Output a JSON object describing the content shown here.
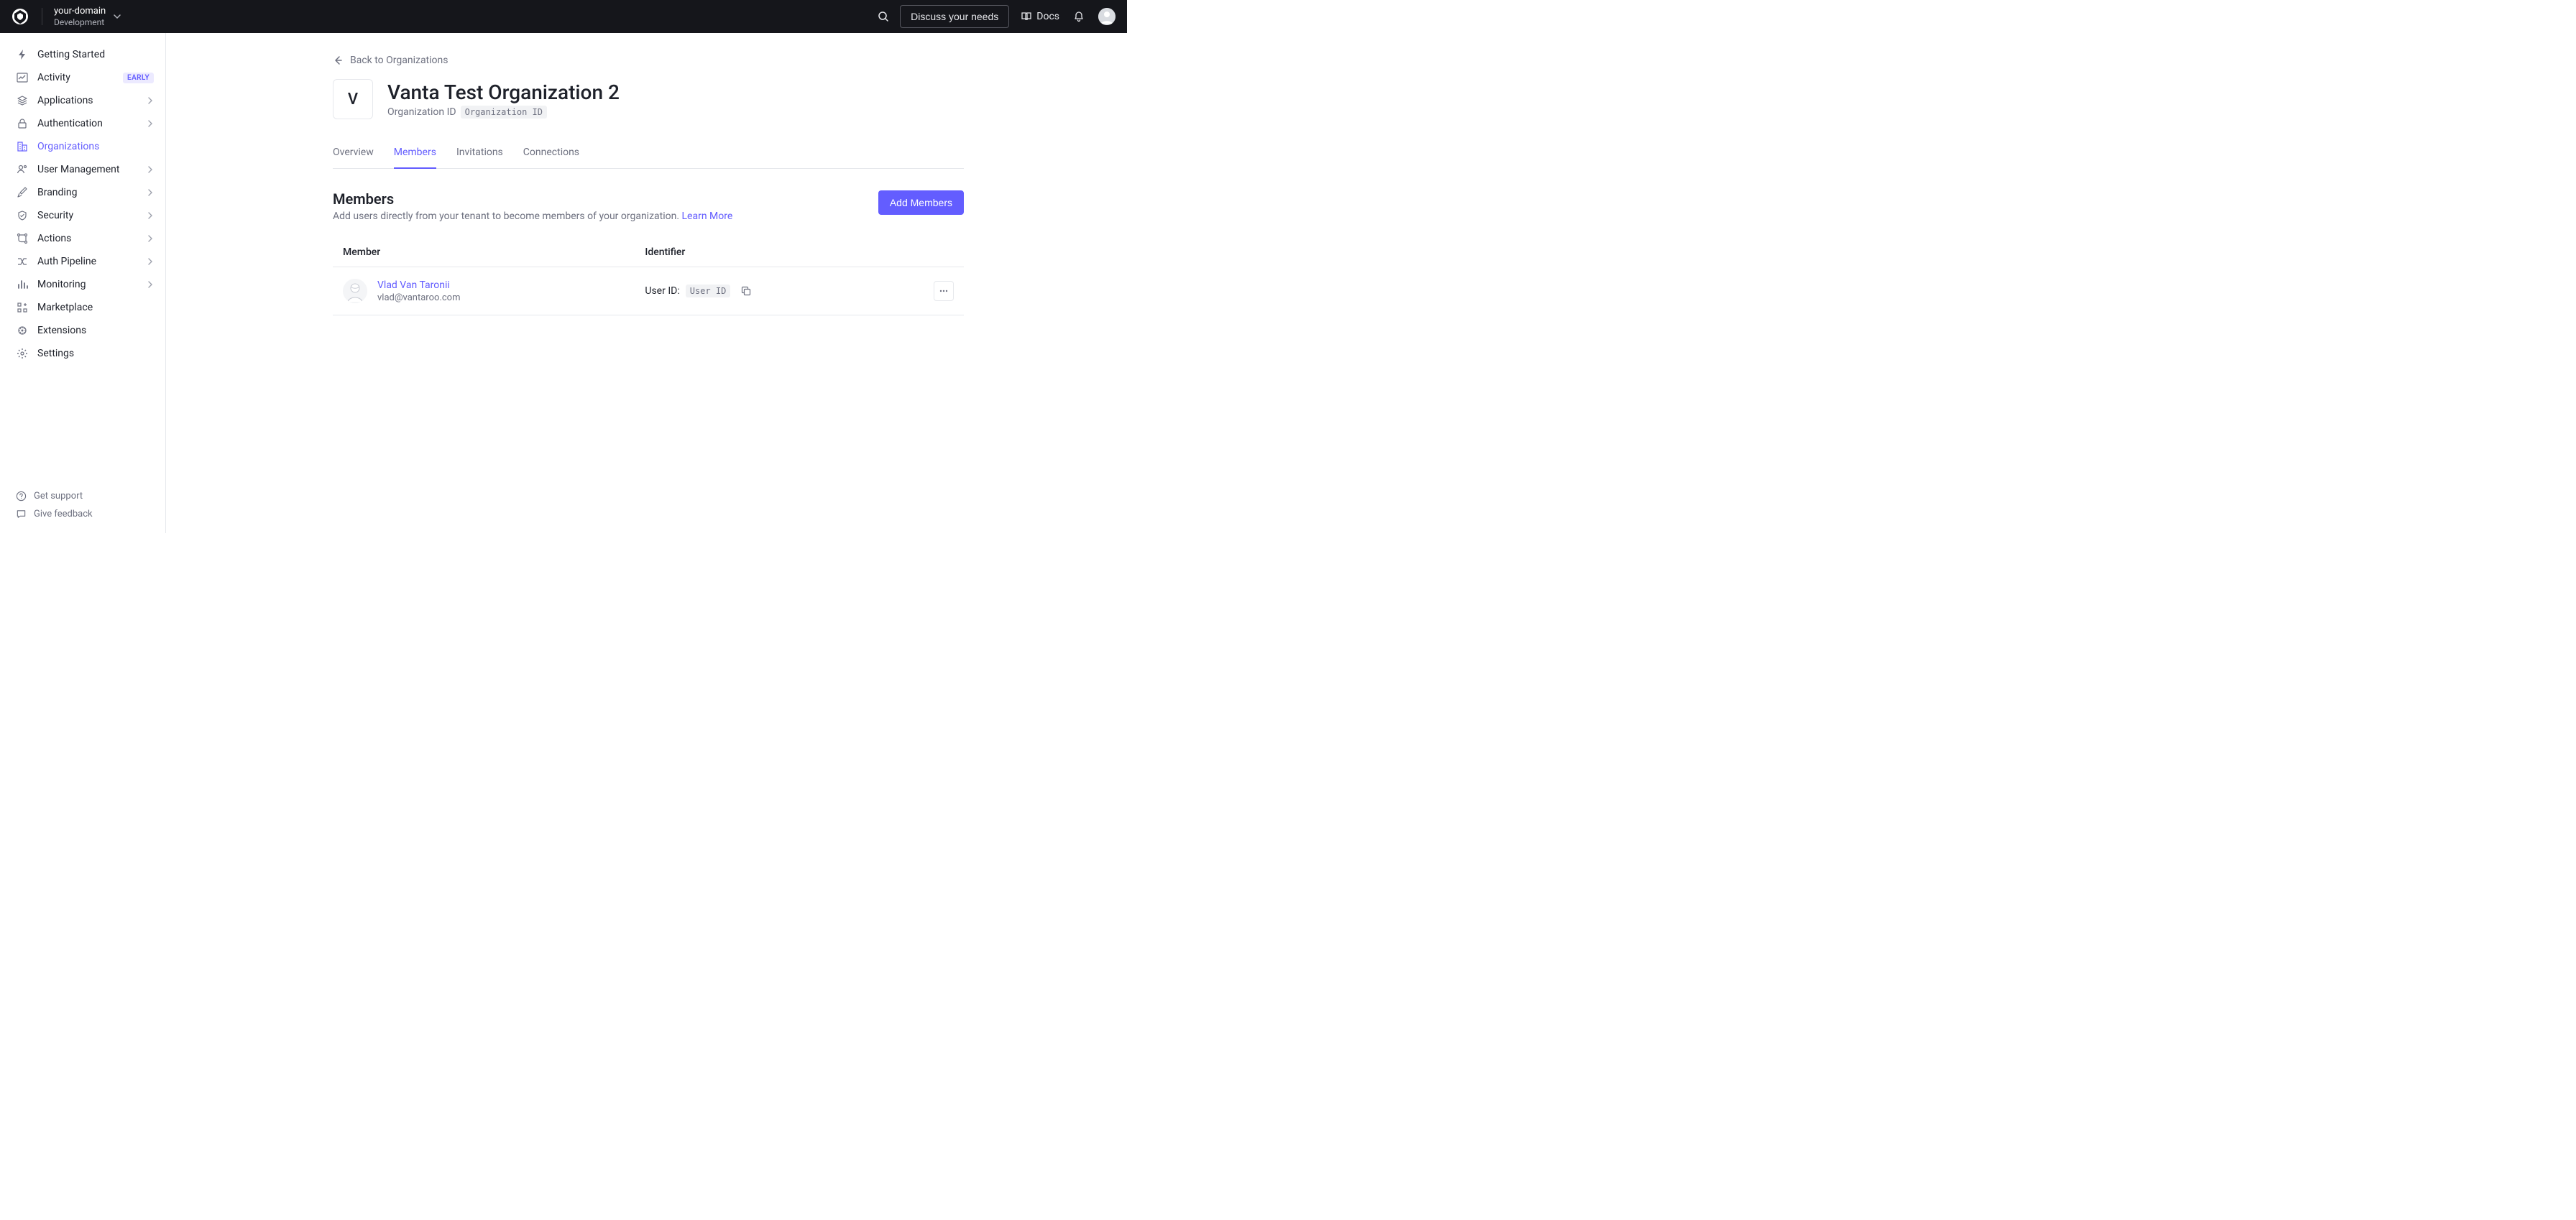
{
  "header": {
    "tenant_name": "your-domain",
    "tenant_env": "Development",
    "discuss_label": "Discuss your needs",
    "docs_label": "Docs"
  },
  "sidebar": {
    "items": [
      {
        "label": "Getting Started",
        "icon": "bolt-icon",
        "expandable": false
      },
      {
        "label": "Activity",
        "icon": "chart-line-icon",
        "expandable": false,
        "badge": "EARLY"
      },
      {
        "label": "Applications",
        "icon": "stack-icon",
        "expandable": true
      },
      {
        "label": "Authentication",
        "icon": "lock-icon",
        "expandable": true
      },
      {
        "label": "Organizations",
        "icon": "building-icon",
        "expandable": false,
        "active": true
      },
      {
        "label": "User Management",
        "icon": "user-icon",
        "expandable": true
      },
      {
        "label": "Branding",
        "icon": "brush-icon",
        "expandable": true
      },
      {
        "label": "Security",
        "icon": "shield-icon",
        "expandable": true
      },
      {
        "label": "Actions",
        "icon": "flow-icon",
        "expandable": true
      },
      {
        "label": "Auth Pipeline",
        "icon": "pipeline-icon",
        "expandable": true
      },
      {
        "label": "Monitoring",
        "icon": "bars-icon",
        "expandable": true
      },
      {
        "label": "Marketplace",
        "icon": "grid-plus-icon",
        "expandable": false
      },
      {
        "label": "Extensions",
        "icon": "puzzle-icon",
        "expandable": false
      },
      {
        "label": "Settings",
        "icon": "gear-icon",
        "expandable": false
      }
    ],
    "footer": {
      "get_support": "Get support",
      "give_feedback": "Give feedback"
    }
  },
  "main": {
    "back_label": "Back to Organizations",
    "org": {
      "initial": "V",
      "title": "Vanta Test Organization 2",
      "sub_label": "Organization ID",
      "sub_code": "Organization ID"
    },
    "tabs": [
      {
        "label": "Overview"
      },
      {
        "label": "Members",
        "active": true
      },
      {
        "label": "Invitations"
      },
      {
        "label": "Connections"
      }
    ],
    "members_section": {
      "title": "Members",
      "description": "Add users directly from your tenant to become members of your organization. ",
      "learn_more": "Learn More",
      "add_button": "Add Members",
      "columns": {
        "member": "Member",
        "identifier": "Identifier"
      },
      "rows": [
        {
          "name": "Vlad Van Taronii",
          "email": "vlad@vantaroo.com",
          "id_label": "User ID:",
          "id_code": "User ID"
        }
      ]
    }
  }
}
